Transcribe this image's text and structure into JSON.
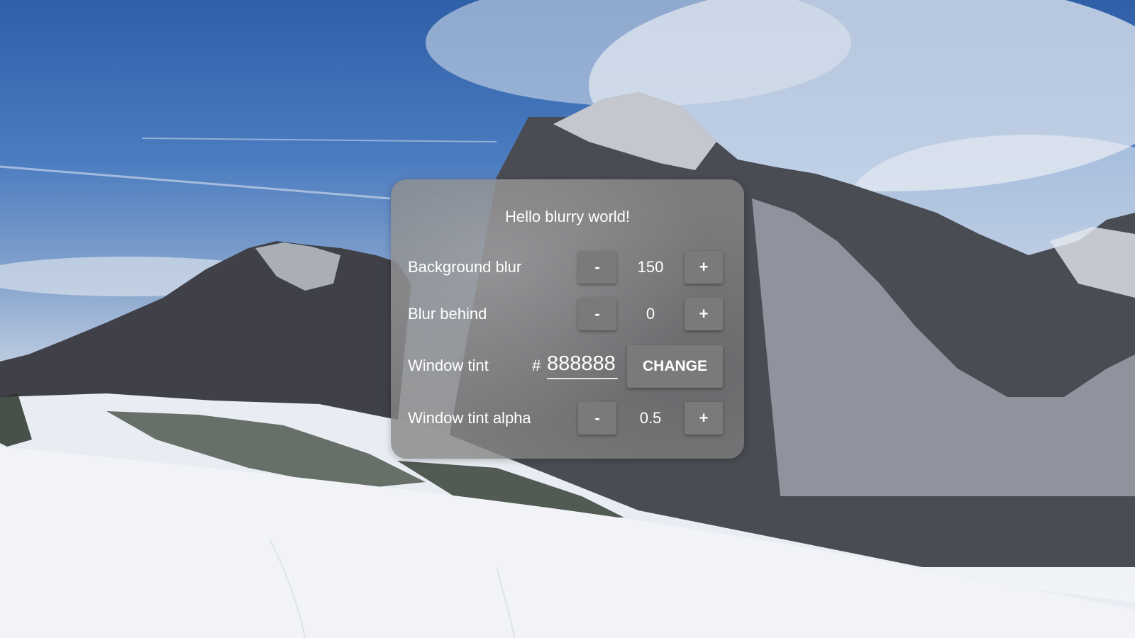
{
  "panel": {
    "title": "Hello blurry world!",
    "tint_color": "#888888",
    "tint_alpha": 0.5
  },
  "rows": {
    "background_blur": {
      "label": "Background blur",
      "decrement_label": "-",
      "value": "150",
      "increment_label": "+"
    },
    "blur_behind": {
      "label": "Blur behind",
      "decrement_label": "-",
      "value": "0",
      "increment_label": "+"
    },
    "window_tint": {
      "label": "Window tint",
      "hash": "#",
      "value": "888888",
      "change_label": "CHANGE"
    },
    "window_tint_alpha": {
      "label": "Window tint alpha",
      "decrement_label": "-",
      "value": "0.5",
      "increment_label": "+"
    }
  }
}
